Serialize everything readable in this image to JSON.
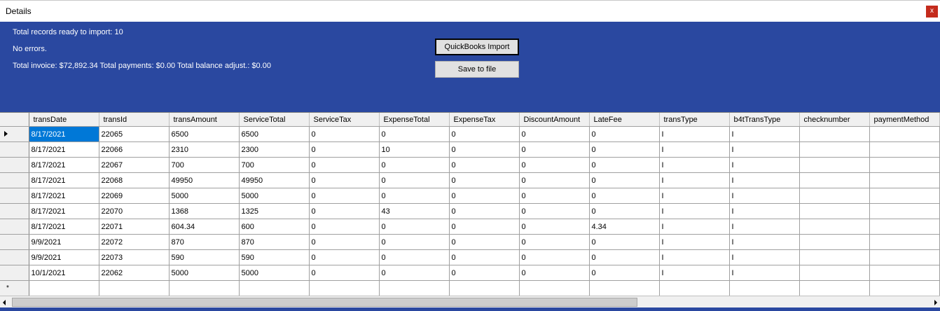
{
  "window": {
    "title": "Details",
    "close_label": "x"
  },
  "summary": {
    "records": "Total records ready to import: 10",
    "errors": "No errors.",
    "totals": "Total invoice: $72,892.34 Total payments: $0.00 Total balance adjust.: $0.00"
  },
  "buttons": {
    "quickbooks": "QuickBooks Import",
    "save": "Save to file"
  },
  "colors": {
    "panel": "#2a48a0",
    "selection": "#0078d7",
    "close": "#c42b1c"
  },
  "table": {
    "columns": [
      "transDate",
      "transId",
      "transAmount",
      "ServiceTotal",
      "ServiceTax",
      "ExpenseTotal",
      "ExpenseTax",
      "DiscountAmount",
      "LateFee",
      "transType",
      "b4tTransType",
      "checknumber",
      "paymentMethod"
    ],
    "rows": [
      [
        "8/17/2021",
        "22065",
        "6500",
        "6500",
        "0",
        "0",
        "0",
        "0",
        "0",
        "I",
        "I",
        "",
        ""
      ],
      [
        "8/17/2021",
        "22066",
        "2310",
        "2300",
        "0",
        "10",
        "0",
        "0",
        "0",
        "I",
        "I",
        "",
        ""
      ],
      [
        "8/17/2021",
        "22067",
        "700",
        "700",
        "0",
        "0",
        "0",
        "0",
        "0",
        "I",
        "I",
        "",
        ""
      ],
      [
        "8/17/2021",
        "22068",
        "49950",
        "49950",
        "0",
        "0",
        "0",
        "0",
        "0",
        "I",
        "I",
        "",
        ""
      ],
      [
        "8/17/2021",
        "22069",
        "5000",
        "5000",
        "0",
        "0",
        "0",
        "0",
        "0",
        "I",
        "I",
        "",
        ""
      ],
      [
        "8/17/2021",
        "22070",
        "1368",
        "1325",
        "0",
        "43",
        "0",
        "0",
        "0",
        "I",
        "I",
        "",
        ""
      ],
      [
        "8/17/2021",
        "22071",
        "604.34",
        "600",
        "0",
        "0",
        "0",
        "0",
        "4.34",
        "I",
        "I",
        "",
        ""
      ],
      [
        "9/9/2021",
        "22072",
        "870",
        "870",
        "0",
        "0",
        "0",
        "0",
        "0",
        "I",
        "I",
        "",
        ""
      ],
      [
        "9/9/2021",
        "22073",
        "590",
        "590",
        "0",
        "0",
        "0",
        "0",
        "0",
        "I",
        "I",
        "",
        ""
      ],
      [
        "10/1/2021",
        "22062",
        "5000",
        "5000",
        "0",
        "0",
        "0",
        "0",
        "0",
        "I",
        "I",
        "",
        ""
      ]
    ],
    "new_row_marker": "*"
  }
}
